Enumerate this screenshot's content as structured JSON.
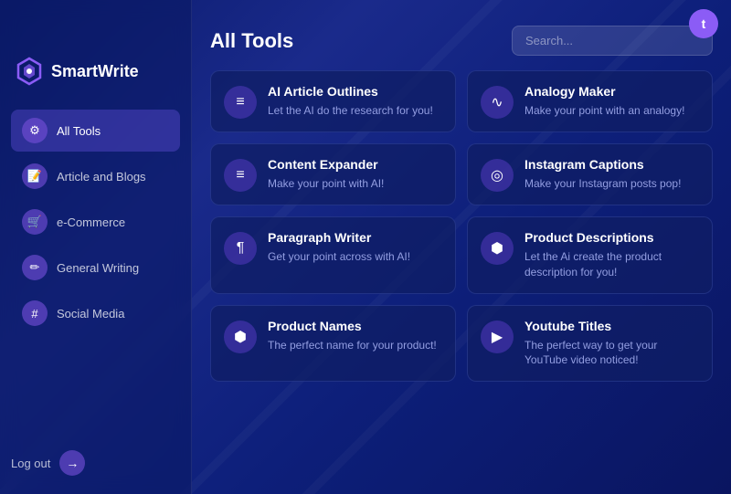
{
  "app": {
    "name": "SmartWrite",
    "avatar_initial": "t"
  },
  "sidebar": {
    "items": [
      {
        "id": "all-tools",
        "label": "All Tools",
        "icon": "⚙",
        "active": true
      },
      {
        "id": "article-blogs",
        "label": "Article and Blogs",
        "icon": "📝",
        "active": false
      },
      {
        "id": "ecommerce",
        "label": "e-Commerce",
        "icon": "🛒",
        "active": false
      },
      {
        "id": "general-writing",
        "label": "General Writing",
        "icon": "✏",
        "active": false
      },
      {
        "id": "social-media",
        "label": "Social Media",
        "icon": "#",
        "active": false
      }
    ],
    "logout_label": "Log out"
  },
  "main": {
    "title": "All Tools",
    "search_placeholder": "Search..."
  },
  "tools": [
    {
      "id": "ai-article-outlines",
      "title": "AI Article Outlines",
      "description": "Let the AI do the research for you!",
      "icon": "≡"
    },
    {
      "id": "analogy-maker",
      "title": "Analogy Maker",
      "description": "Make your point with an analogy!",
      "icon": "〰"
    },
    {
      "id": "content-expander",
      "title": "Content Expander",
      "description": "Make your point with AI!",
      "icon": "≡"
    },
    {
      "id": "instagram-captions",
      "title": "Instagram Captions",
      "description": "Make your Instagram posts pop!",
      "icon": "◎"
    },
    {
      "id": "paragraph-writer",
      "title": "Paragraph Writer",
      "description": "Get your point across with AI!",
      "icon": "¶"
    },
    {
      "id": "product-descriptions",
      "title": "Product Descriptions",
      "description": "Let the Ai create the product description for you!",
      "icon": "⬡"
    },
    {
      "id": "product-names",
      "title": "Product Names",
      "description": "The perfect name for your product!",
      "icon": "⬡"
    },
    {
      "id": "youtube-titles",
      "title": "Youtube Titles",
      "description": "The perfect way to get your YouTube video noticed!",
      "icon": "▶"
    }
  ]
}
